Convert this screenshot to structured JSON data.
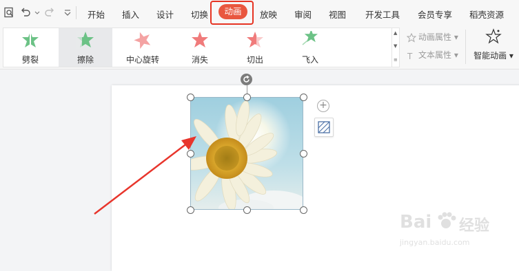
{
  "menu": {
    "items": [
      "开始",
      "插入",
      "设计",
      "切换",
      "动画",
      "放映",
      "审阅",
      "视图",
      "开发工具",
      "会员专享",
      "稻壳资源"
    ],
    "active": "动画"
  },
  "ribbon": {
    "effects": [
      {
        "label": "劈裂",
        "icon": "split-star-icon"
      },
      {
        "label": "擦除",
        "icon": "wipe-star-icon",
        "selected": true
      },
      {
        "label": "中心旋转",
        "icon": "spin-star-icon"
      },
      {
        "label": "消失",
        "icon": "disappear-star-icon"
      },
      {
        "label": "切出",
        "icon": "cut-out-star-icon"
      },
      {
        "label": "飞入",
        "icon": "fly-in-star-icon"
      }
    ],
    "anim_props": "动画属性",
    "text_props": "文本属性",
    "smart_anim": "智能动画"
  },
  "watermark": {
    "brand": "Bai",
    "brand_cn": "经验",
    "url": "jingyan.baidu.com"
  },
  "colors": {
    "accent": "#e9573f",
    "highlight_box": "#e63322",
    "arrow": "#e8352c",
    "star_green": "#6cc286",
    "star_red": "#f07b7b"
  }
}
